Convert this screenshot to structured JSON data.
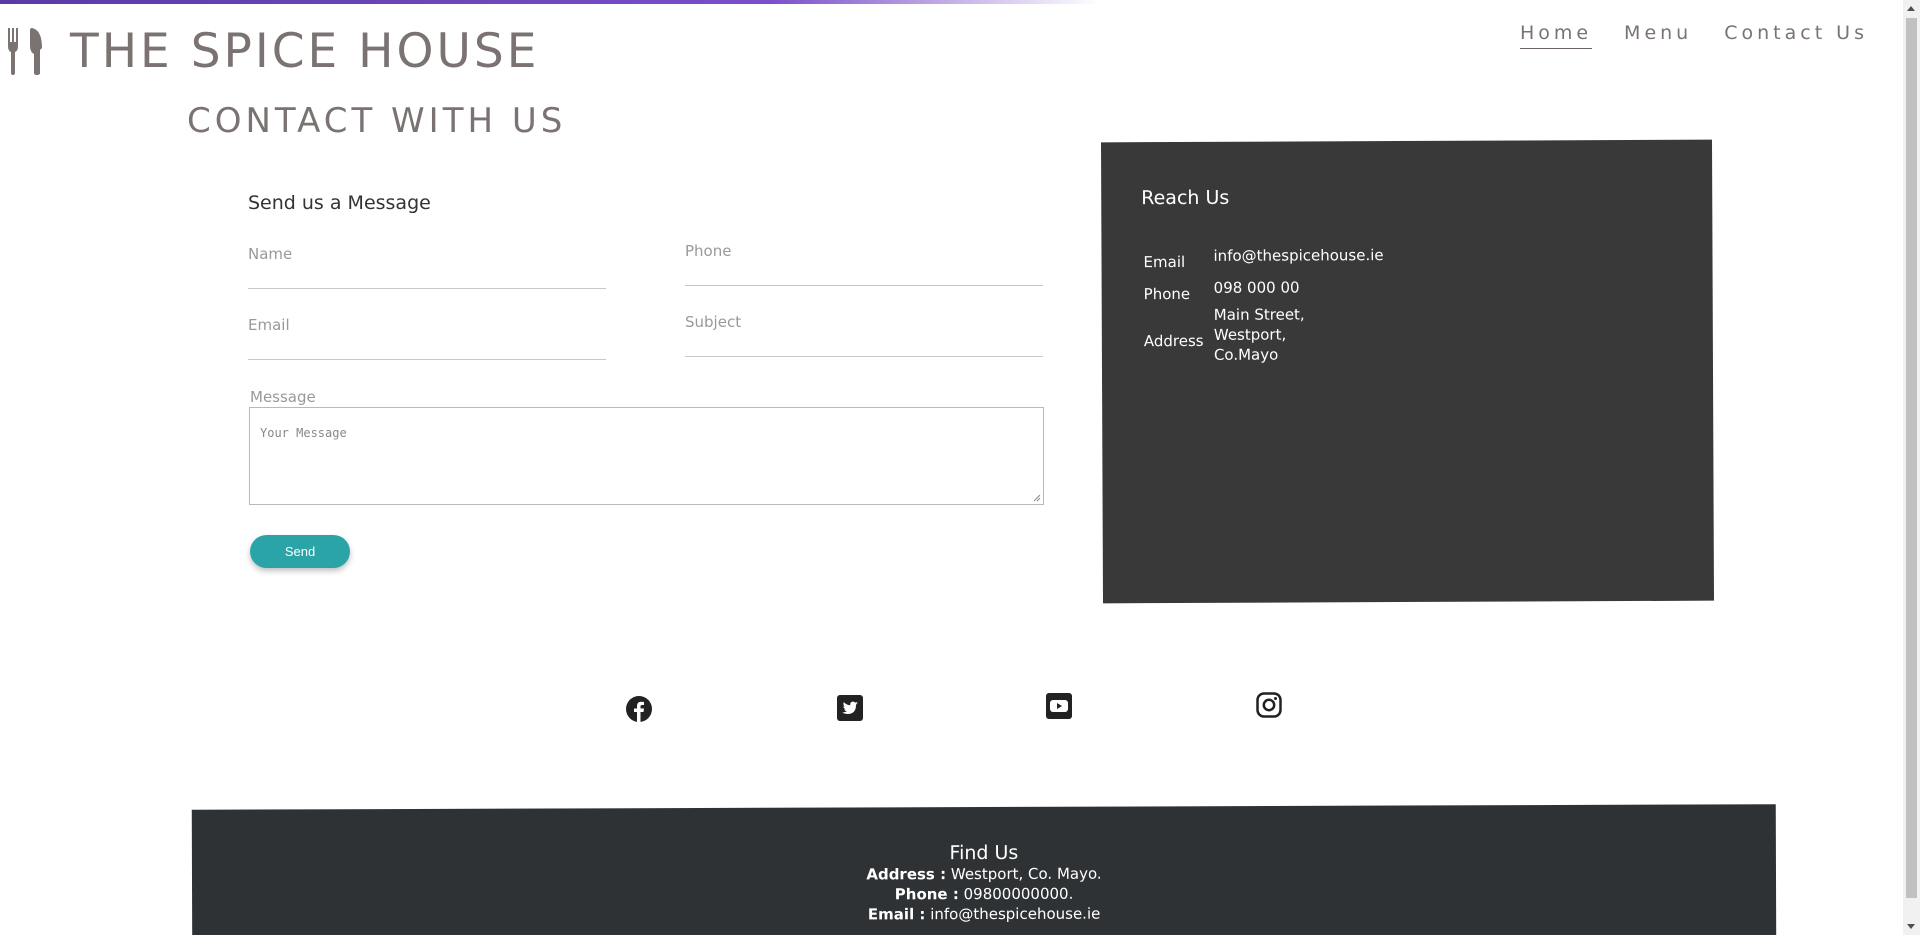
{
  "brand": {
    "name": "THE SPICE HOUSE",
    "icon": "fork-knife-icon"
  },
  "nav": [
    {
      "label": "Home",
      "active": true
    },
    {
      "label": "Menu",
      "active": false
    },
    {
      "label": "Contact Us",
      "active": false
    }
  ],
  "page": {
    "title": "CONTACT WITH US"
  },
  "form": {
    "title": "Send us a Message",
    "name_label": "Name",
    "phone_label": "Phone",
    "email_label": "Email",
    "subject_label": "Subject",
    "message_label": "Message",
    "message_placeholder": "Your Message",
    "send_label": "Send"
  },
  "reach": {
    "title": "Reach Us",
    "email_label": "Email",
    "email_value": "info@thespicehouse.ie",
    "phone_label": "Phone",
    "phone_value": "098 000 00",
    "address_label": "Address",
    "address_line1": "Main Street,",
    "address_line2": "Westport,",
    "address_line3": "Co.Mayo"
  },
  "social": [
    "facebook-icon",
    "twitter-icon",
    "youtube-icon",
    "instagram-icon"
  ],
  "footer": {
    "title": "Find Us",
    "address_label": "Address :",
    "address_value": "Westport, Co. Mayo.",
    "phone_label": "Phone :",
    "phone_value": "09800000000.",
    "email_label": "Email :",
    "email_value": "info@thespicehouse.ie"
  },
  "colors": {
    "accent": "#2aa4a6",
    "panel": "#393939",
    "footer": "#2f3234",
    "heading": "#7b7272",
    "topbar": "#5b3aa6"
  }
}
